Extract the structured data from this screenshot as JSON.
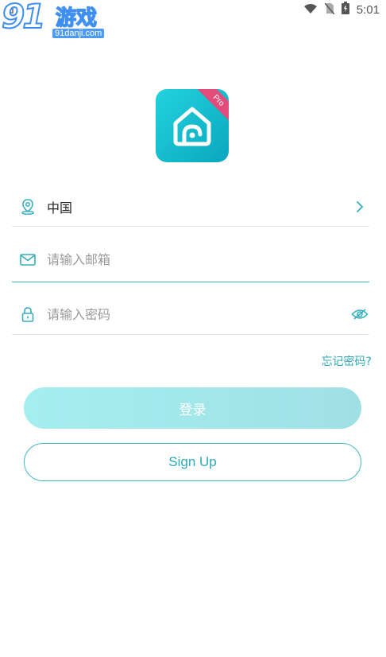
{
  "status_bar": {
    "time": "5:01"
  },
  "watermark": {
    "number": "91",
    "title": "游戏",
    "url": "91danji.com"
  },
  "logo": {
    "badge": "Pro"
  },
  "country": {
    "value": "中国"
  },
  "email": {
    "placeholder": "请输入邮箱",
    "value": ""
  },
  "password": {
    "placeholder": "请输入密码",
    "value": ""
  },
  "forgot_label": "忘记密码?",
  "login_label": "登录",
  "signup_label": "Sign Up",
  "colors": {
    "accent": "#2fa9b8",
    "login_bg": "#a5eef0",
    "badge": "#e24b7a"
  }
}
